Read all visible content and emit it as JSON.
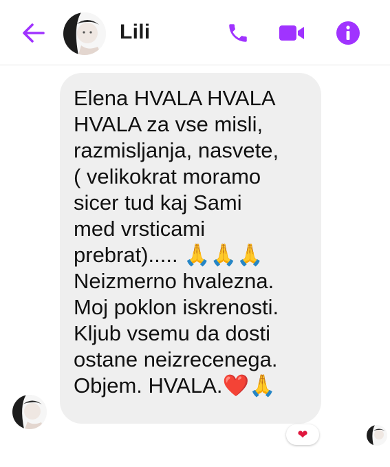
{
  "header": {
    "contact_name": "Lili",
    "icons": {
      "back": "arrow-left-icon",
      "call": "phone-icon",
      "video": "video-camera-icon",
      "info": "info-icon"
    },
    "accent_color": "#a033ff"
  },
  "conversation": {
    "messages": [
      {
        "sender": "Lili",
        "text": "Elena HVALA HVALA\nHVALA za vse misli,\nrazmisljanja, nasvete,\n( velikokrat moramo\nsicer tud kaj Sami\nmed vrsticami\nprebrat)..... 🙏🙏🙏\nNeizmerno hvalezna.\nMoj poklon iskrenosti.\nKljub vsemu da dosti\nostane neizrecenega.\nObjem. HVALA.❤️🙏",
        "reaction": "❤"
      }
    ],
    "bubble_color": "#efefef",
    "reaction_color": "#e0173e"
  }
}
